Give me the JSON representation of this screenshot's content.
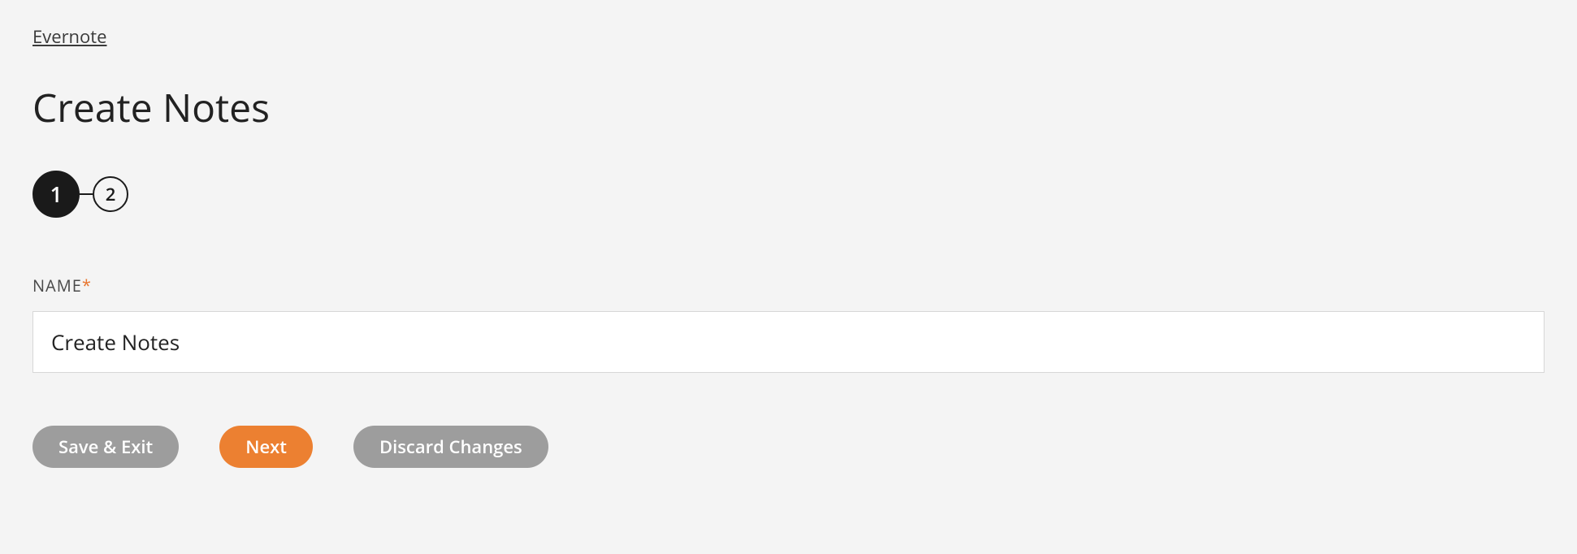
{
  "breadcrumb": {
    "label": "Evernote"
  },
  "page_title": "Create Notes",
  "stepper": {
    "steps": [
      "1",
      "2"
    ],
    "active_index": 0
  },
  "form": {
    "name_label": "NAME",
    "name_required_mark": "*",
    "name_value": "Create Notes"
  },
  "buttons": {
    "save_exit": "Save & Exit",
    "next": "Next",
    "discard": "Discard Changes"
  }
}
